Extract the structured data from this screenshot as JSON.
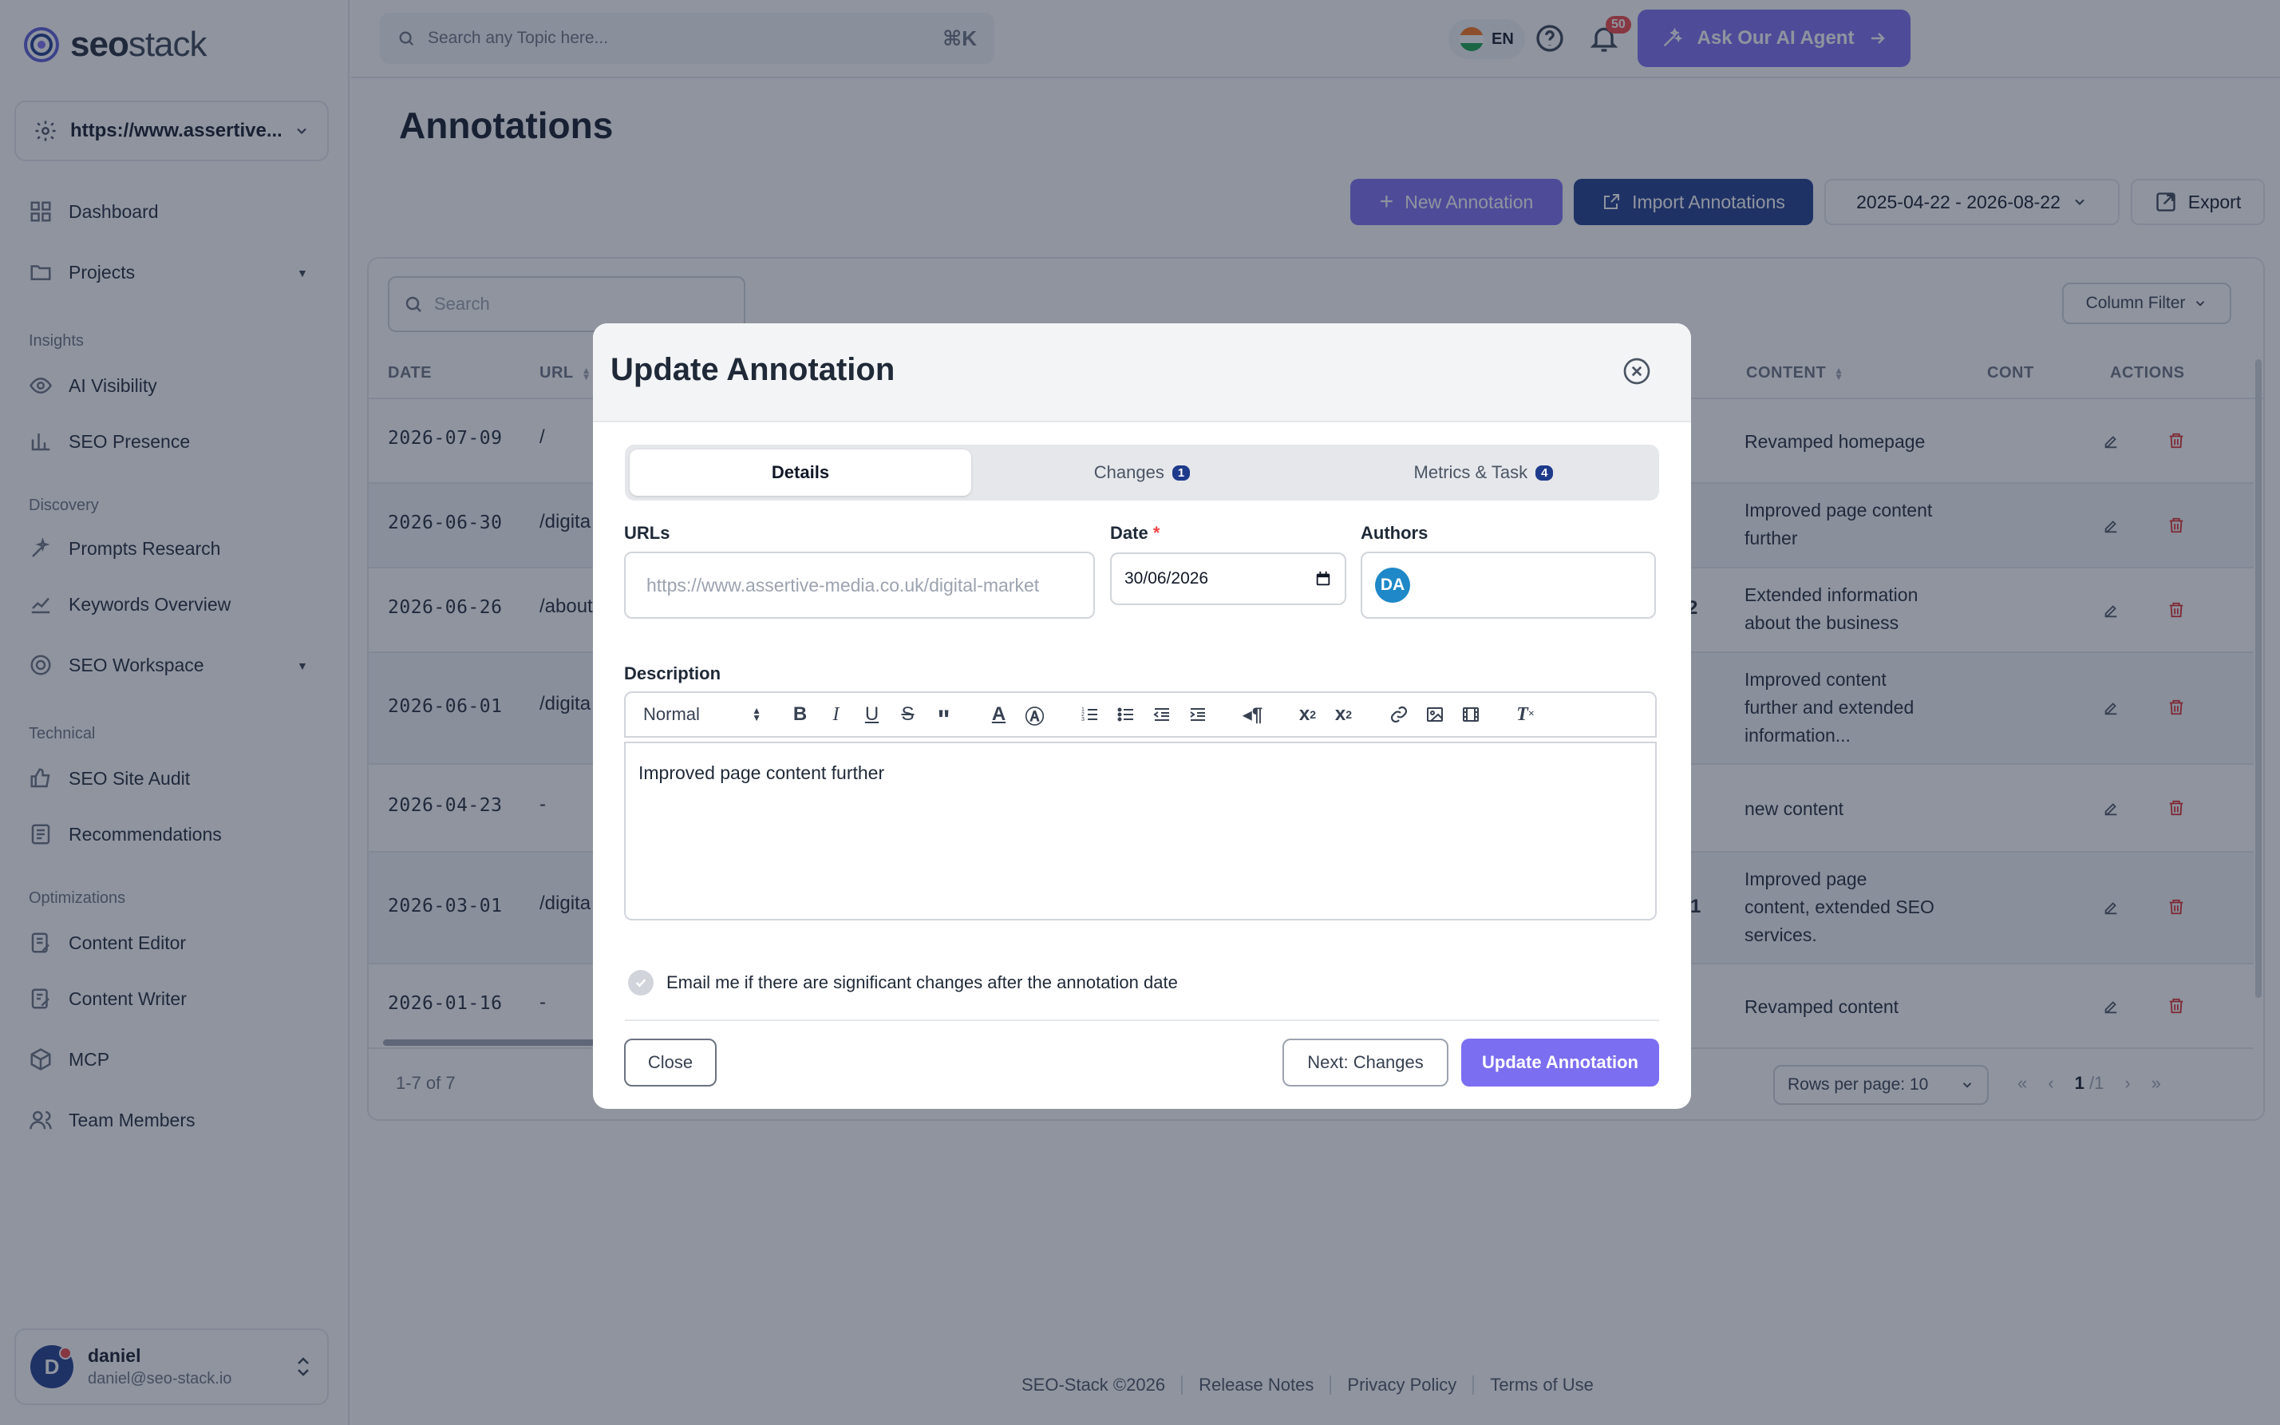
{
  "brand": {
    "name_bold": "seo",
    "name_light": "stack"
  },
  "site": {
    "url": "https://www.assertive..."
  },
  "nav": {
    "dashboard": "Dashboard",
    "projects": "Projects",
    "insights": "Insights",
    "ai_visibility": "AI Visibility",
    "seo_presence": "SEO Presence",
    "discovery": "Discovery",
    "prompts_research": "Prompts Research",
    "keywords_overview": "Keywords Overview",
    "seo_workspace": "SEO Workspace",
    "technical": "Technical",
    "seo_site_audit": "SEO Site Audit",
    "recommendations": "Recommendations",
    "optimizations": "Optimizations",
    "content_editor": "Content Editor",
    "content_writer": "Content Writer",
    "mcp": "MCP",
    "team_members": "Team Members"
  },
  "user": {
    "initial": "D",
    "name": "daniel",
    "email": "daniel@seo-stack.io"
  },
  "topbar": {
    "search_placeholder": "Search any Topic here...",
    "shortcut": "⌘K",
    "lang": "EN",
    "notifications": "50",
    "ai_agent": "Ask Our AI Agent"
  },
  "page": {
    "title": "Annotations",
    "new_annotation": "New Annotation",
    "import_annotations": "Import Annotations",
    "date_range": "2025-04-22 - 2026-08-22",
    "export": "Export"
  },
  "table": {
    "search_placeholder": "Search",
    "column_filter": "Column Filter",
    "headers": {
      "date": "DATE",
      "url": "URL",
      "content": "CONTENT",
      "cont": "CONT",
      "actions": "ACTIONS"
    },
    "rows": [
      {
        "date": "2026-07-09",
        "url": "/",
        "extra": "",
        "content": "Revamped homepage"
      },
      {
        "date": "2026-06-30",
        "url": "/digita",
        "extra": "",
        "content": "Improved page content further"
      },
      {
        "date": "2026-06-26",
        "url": "/about",
        "extra": "2",
        "content": "Extended information about the business"
      },
      {
        "date": "2026-06-01",
        "url": "/digita",
        "extra": "",
        "content": "Improved content further and extended information..."
      },
      {
        "date": "2026-04-23",
        "url": "-",
        "extra": "",
        "content": "new content"
      },
      {
        "date": "2026-03-01",
        "url": "/digita",
        "extra": "1",
        "content": "Improved page content, extended SEO services."
      },
      {
        "date": "2026-01-16",
        "url": "-",
        "extra": "",
        "content": "Revamped content"
      }
    ],
    "pager_info": "1-7 of 7",
    "rows_per_page": "Rows per page: 10",
    "page_current": "1",
    "page_total": "/1"
  },
  "footer": {
    "copyright": "SEO-Stack ©2026",
    "release_notes": "Release Notes",
    "privacy": "Privacy Policy",
    "terms": "Terms of Use"
  },
  "modal": {
    "title": "Update Annotation",
    "tabs": [
      {
        "label": "Details",
        "badge": ""
      },
      {
        "label": "Changes",
        "badge": "1"
      },
      {
        "label": "Metrics & Task",
        "badge": "4"
      }
    ],
    "urls_label": "URLs",
    "urls_value": "https://www.assertive-media.co.uk/digital-market",
    "date_label": "Date",
    "date_required": "*",
    "date_value": "30/06/2026",
    "authors_label": "Authors",
    "author_initials": "DA",
    "description_label": "Description",
    "format_select": "Normal",
    "description_text": "Improved page content further",
    "email_option": "Email me if there are significant changes after the annotation date",
    "close": "Close",
    "next": "Next: Changes",
    "update": "Update Annotation"
  },
  "colors": {
    "accent": "#7c6ef0",
    "navy": "#1e3a8a",
    "danger": "#dc2626",
    "overlay": "#1f2940"
  }
}
